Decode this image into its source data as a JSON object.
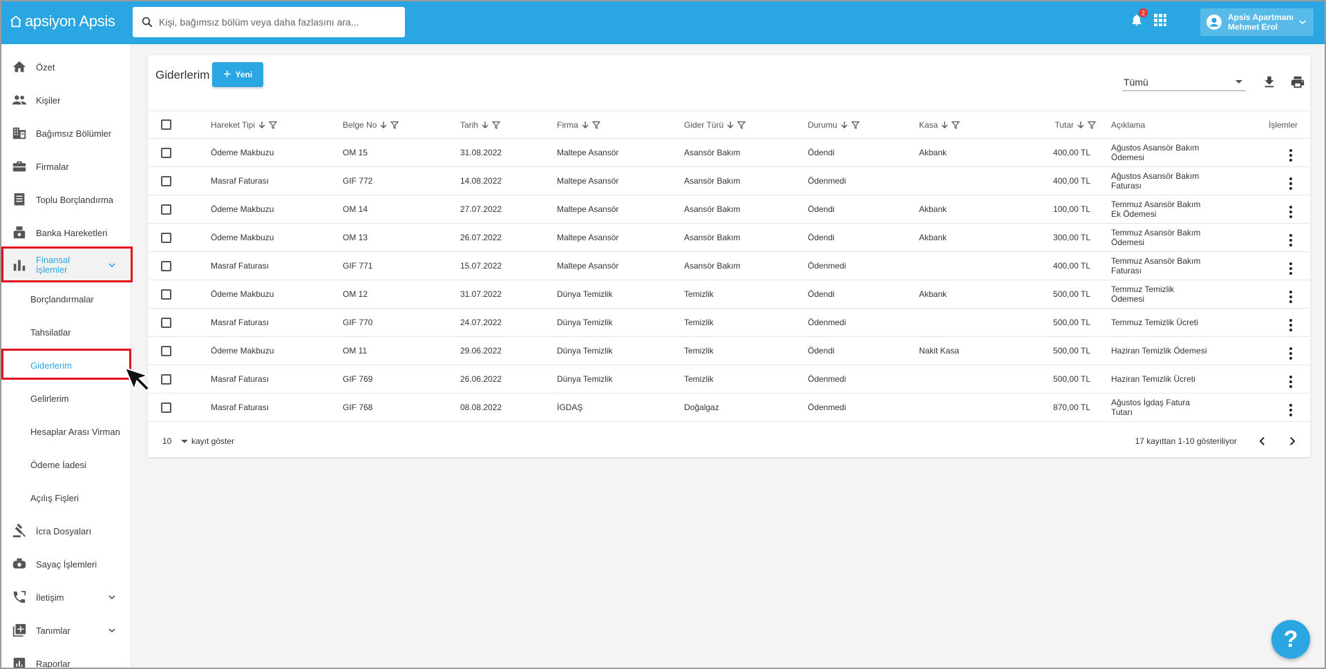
{
  "app": {
    "logo_text": "apsiyon Apsis"
  },
  "search": {
    "placeholder": "Kişi, bağımsız bölüm veya daha fazlasını ara..."
  },
  "header": {
    "notification_count": "2",
    "user_line1": "Apsis Apartmanı",
    "user_line2": "Mehmet Erol"
  },
  "sidebar": {
    "items": [
      {
        "label": "Özet",
        "icon": "home-icon"
      },
      {
        "label": "Kişiler",
        "icon": "people-icon"
      },
      {
        "label": "Bağımsız Bölümler",
        "icon": "building-icon"
      },
      {
        "label": "Firmalar",
        "icon": "briefcase-icon"
      },
      {
        "label": "Toplu Borçlandırma",
        "icon": "receipt-icon"
      },
      {
        "label": "Banka Hareketleri",
        "icon": "bank-icon"
      },
      {
        "label": "Finansal İşlemler",
        "icon": "bar-chart-icon"
      }
    ],
    "sub_items": [
      "Borçlandırmalar",
      "Tahsilatlar",
      "Giderlerim",
      "Gelirlerim",
      "Hesaplar Arası Virman",
      "Ödeme İadesi",
      "Açılış Fişleri"
    ],
    "bottom_items": [
      {
        "label": "İcra Dosyaları",
        "icon": "gavel-icon"
      },
      {
        "label": "Sayaç İşlemleri",
        "icon": "meter-icon"
      },
      {
        "label": "İletişim",
        "icon": "phone-icon"
      },
      {
        "label": "Tanımlar",
        "icon": "library-add-icon"
      },
      {
        "label": "Raporlar",
        "icon": "report-icon"
      }
    ]
  },
  "page": {
    "title": "Giderlerim",
    "new_button": "Yeni",
    "filter_value": "Tümü"
  },
  "table": {
    "columns": [
      "Hareket Tipi",
      "Belge No",
      "Tarih",
      "Firma",
      "Gider Türü",
      "Durumu",
      "Kasa",
      "Tutar",
      "Açıklama",
      "İşlemler"
    ],
    "rows": [
      [
        "Ödeme Makbuzu",
        "OM 15",
        "31.08.2022",
        "Maltepe Asansör",
        "Asansör Bakım",
        "Ödendi",
        "Akbank",
        "400,00 TL",
        "Ağustos Asansör Bakım Ödemesi"
      ],
      [
        "Masraf Faturası",
        "GIF 772",
        "14.08.2022",
        "Maltepe Asansör",
        "Asansör Bakım",
        "Ödenmedi",
        "",
        "400,00 TL",
        "Ağustos Asansör Bakım Faturası"
      ],
      [
        "Ödeme Makbuzu",
        "OM 14",
        "27.07.2022",
        "Maltepe Asansör",
        "Asansör Bakım",
        "Ödendi",
        "Akbank",
        "100,00 TL",
        "Temmuz Asansör Bakım Ek Ödemesi"
      ],
      [
        "Ödeme Makbuzu",
        "OM 13",
        "26.07.2022",
        "Maltepe Asansör",
        "Asansör Bakım",
        "Ödendi",
        "Akbank",
        "300,00 TL",
        "Temmuz Asansör Bakım Ödemesi"
      ],
      [
        "Masraf Faturası",
        "GIF 771",
        "15.07.2022",
        "Maltepe Asansör",
        "Asansör Bakım",
        "Ödenmedi",
        "",
        "400,00 TL",
        "Temmuz Asansör Bakım Faturası"
      ],
      [
        "Ödeme Makbuzu",
        "OM 12",
        "31.07.2022",
        "Dünya Temizlik",
        "Temizlik",
        "Ödendi",
        "Akbank",
        "500,00 TL",
        "Temmuz Temizlik Ödemesi"
      ],
      [
        "Masraf Faturası",
        "GIF 770",
        "24.07.2022",
        "Dünya Temizlik",
        "Temizlik",
        "Ödenmedi",
        "",
        "500,00 TL",
        "Temmuz Temizlik Ücreti"
      ],
      [
        "Ödeme Makbuzu",
        "OM 11",
        "29.06.2022",
        "Dünya Temizlik",
        "Temizlik",
        "Ödendi",
        "Nakit Kasa",
        "500,00 TL",
        "Haziran Temizlik Ödemesi"
      ],
      [
        "Masraf Faturası",
        "GIF 769",
        "26.06.2022",
        "Dünya Temizlik",
        "Temizlik",
        "Ödenmedi",
        "",
        "500,00 TL",
        "Haziran Temizlik Ücreti"
      ],
      [
        "Masraf Faturası",
        "GIF 768",
        "08.08.2022",
        "İGDAŞ",
        "Doğalgaz",
        "Ödenmedi",
        "",
        "870,00 TL",
        "Ağustos İgdaş Fatura Tutarı"
      ]
    ]
  },
  "footer": {
    "per_page": "10",
    "per_page_label": "kayıt göster",
    "info": "17 kayıttan 1-10 gösteriliyor"
  },
  "help": {
    "label": "?"
  },
  "colors": {
    "primary": "#2aa7e2",
    "highlight": "#e3101b"
  }
}
